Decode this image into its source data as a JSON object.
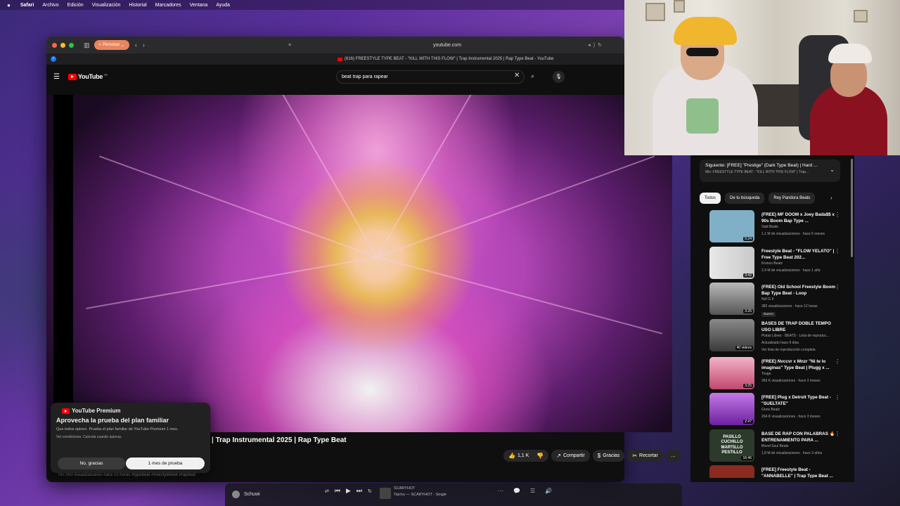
{
  "menubar": {
    "apple": "",
    "app": "Safari",
    "items": [
      "Archivo",
      "Edición",
      "Visualización",
      "Historial",
      "Marcadores",
      "Ventana",
      "Ayuda"
    ]
  },
  "browser": {
    "profile": "Personal",
    "url": "youtube.com",
    "tab_title": "(616) FREESTYLE TYPE BEAT - \"KILL WITH THIS FLOW\" | Trap Instrumental 2025 | Rap Type Beat - YouTube"
  },
  "youtube": {
    "logo_text": "YouTube",
    "logo_sup": "PE",
    "search_value": "beat trap para rapear"
  },
  "video": {
    "title_visible": "| Trap Instrumental 2025 | Rap Type Beat",
    "desc_cut": "797.000 visualizaciones  hace 10 horas  #typebeat #freestylebeat #rapbeat"
  },
  "actions": {
    "likes": "1,1 K",
    "share": "Compartir",
    "thanks": "Gracias",
    "clip": "Recortar",
    "more": "…"
  },
  "premium": {
    "brand": "YouTube Premium",
    "headline": "Aprovecha la prueba del plan familiar",
    "body": "Que todos opinen. Prueba el plan familiar de YouTube Premium 1 mes.",
    "terms": "Ver condiciones. Cancela cuando quieras.",
    "decline": "No, gracias",
    "accept": "1 mes de prueba"
  },
  "upnext": {
    "title": "Siguiente: [FREE] \"Prestige\" (Dark Type Beat) | Hard ...",
    "subtitle": "Mix: FREESTYLE TYPE BEAT - \"KILL WITH THIS FLOW\" | Trap..."
  },
  "chips": [
    "Todos",
    "De tu búsqueda",
    "Rey Pandora Beats"
  ],
  "recommendations": [
    {
      "title": "(FREE) MF DOOM x Joey Bada$$ x 90s Boom Bap Type ...",
      "channel": "Vadi Beats",
      "meta": "1,1 M de visualizaciones · hace 5 meses",
      "extra": "",
      "badge": "",
      "duration": "5:24",
      "thumb_color": "#7fb0c8"
    },
    {
      "title": "Freestyle Beat - \"FLOW YELATO\" | Free Type Beat 202...",
      "channel": "Kronos Beatz",
      "meta": "2,4 M de visualizaciones · hace 1 año",
      "extra": "",
      "badge": "",
      "duration": "3:42",
      "thumb_color": "#d8d8d8"
    },
    {
      "title": "(FREE) Old School Freestyle Boom Bap Type Beat - Loop",
      "channel": "Nof G II",
      "meta": "382 visualizaciones · hace 12 horas",
      "extra": "",
      "badge": "Nuevo",
      "duration": "3:26",
      "thumb_color": "#8a8a8a"
    },
    {
      "title": "BASES DE TRAP DOBLE TEMPO USO LIBRE",
      "channel": "Pistas Libres · BEATS · Lista de reproduc...",
      "meta": "Actualizado hace 6 días",
      "extra": "Ver lista de reproducción completa",
      "badge": "",
      "duration": "40 videos",
      "thumb_color": "#6a6a6a"
    },
    {
      "title": "(FREE) Nvccvr x Mnzr \"Ni te lo imaginas\" Type Beat | Plugg x ...",
      "channel": "Tsuga",
      "meta": "266 K visualizaciones · hace 2 meses",
      "extra": "",
      "badge": "",
      "duration": "3:25",
      "thumb_color": "#e07a9c"
    },
    {
      "title": "[FREE] Plug x Detroit Type Beat - \"SUELTATE\"",
      "channel": "Grow Beatz",
      "meta": "204 K visualizaciones · hace 3 meses",
      "extra": "",
      "badge": "",
      "duration": "2:47",
      "thumb_color": "#a64bd6"
    },
    {
      "title": "BASE DE RAP CON PALABRAS 🔥 ENTRENAMIENTO PARA ...",
      "channel": "Blood Soul Beats",
      "meta": "1,8 M de visualizaciones · hace 3 años",
      "extra": "",
      "badge": "",
      "duration": "16:46",
      "thumb_color": "#2b3a2a",
      "thumb_text": "PASILLO CUCHILLO MARTILLO PESTILLO"
    },
    {
      "title": "[FREE] Freestyle Beat - \"ANNABELLE\" | Trap Type Beat ...",
      "channel": "",
      "meta": "",
      "extra": "",
      "badge": "",
      "duration": "",
      "thumb_color": "#8a2a20"
    }
  ],
  "dock": {
    "app_name": "Schuwi",
    "track": "SCARYHOT",
    "track_sub": "Taichu — SCARYHOT - Single"
  },
  "colors": {
    "yt_red": "#ff0000",
    "yt_bg": "#0f0f0f",
    "chip_bg": "#272727",
    "profile_pill": "#e8855e"
  }
}
